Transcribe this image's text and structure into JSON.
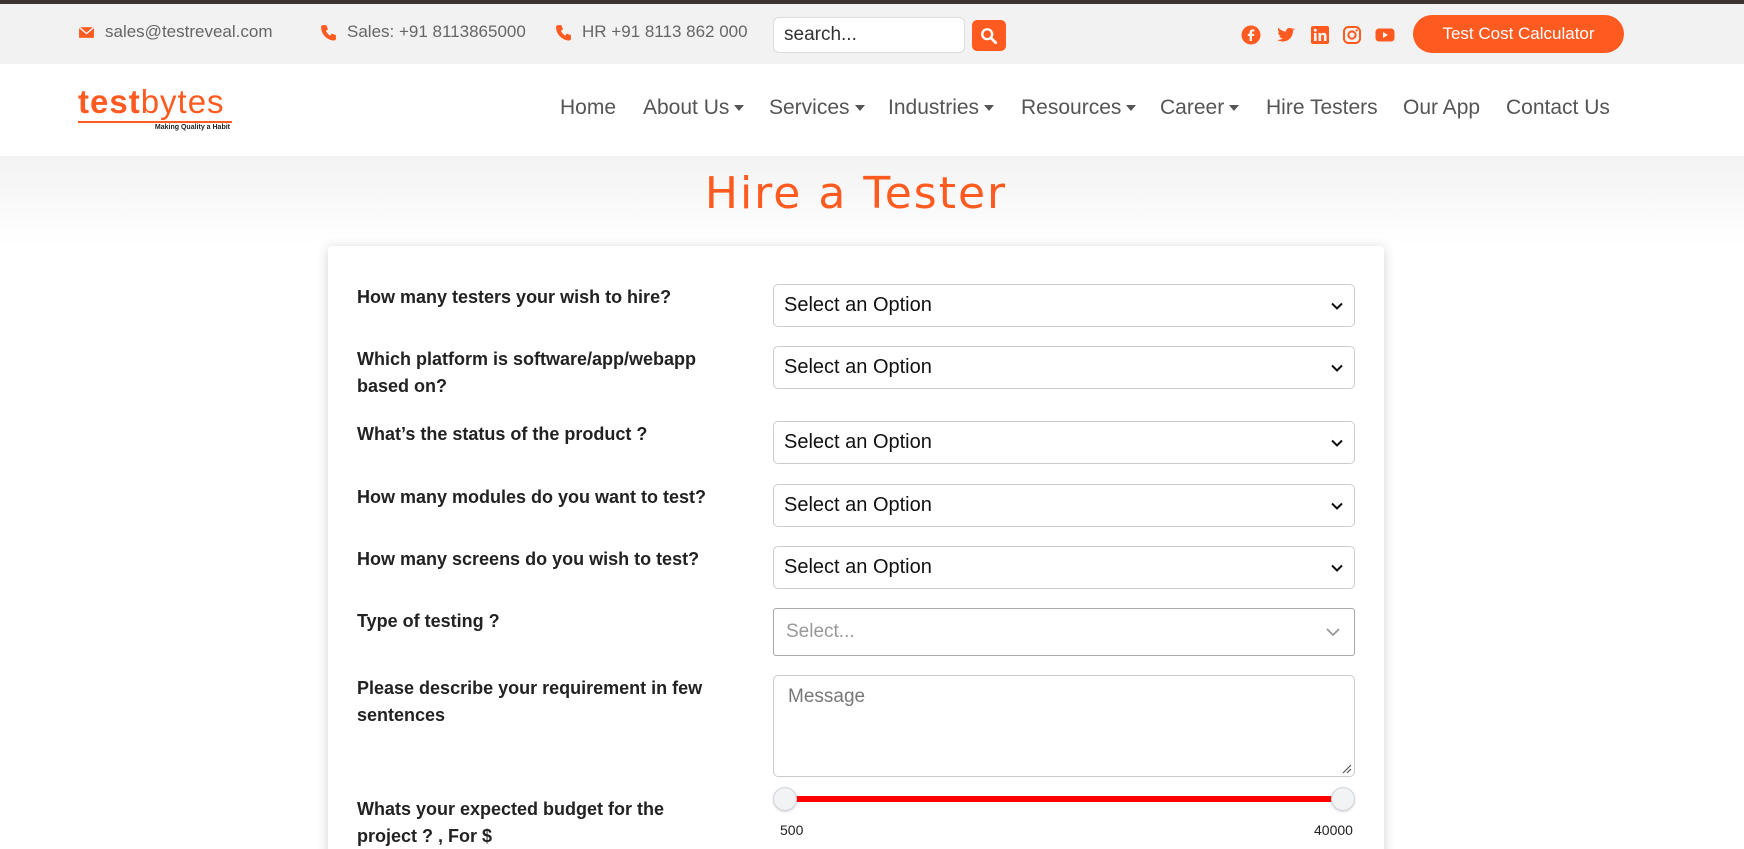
{
  "topbar": {
    "email": "sales@testreveal.com",
    "sales_phone": "Sales: +91 8113865000",
    "hr_phone": "HR +91 8113 862 000",
    "search_placeholder": "search...",
    "social_icons": [
      "facebook-icon",
      "twitter-icon",
      "linkedin-icon",
      "instagram-icon",
      "youtube-icon"
    ],
    "cta_label": "Test Cost Calculator"
  },
  "logo": {
    "part1": "test",
    "part2": "bytes",
    "tagline": "Making Quality a Habit"
  },
  "nav": {
    "items": [
      {
        "label": "Home"
      },
      {
        "label": "About Us"
      },
      {
        "label": "Services"
      },
      {
        "label": "Industries"
      },
      {
        "label": "Resources"
      },
      {
        "label": "Career"
      },
      {
        "label": "Hire Testers"
      },
      {
        "label": "Our App"
      },
      {
        "label": "Contact Us"
      }
    ]
  },
  "page": {
    "title": "Hire a Tester"
  },
  "form": {
    "questions": [
      {
        "label": "How many testers your wish to hire?",
        "value": "Select an Option"
      },
      {
        "label": "Which platform is software/app/webapp based on?",
        "value": "Select an Option"
      },
      {
        "label": "What’s the status of the product ?",
        "value": "Select an Option"
      },
      {
        "label": "How many modules do you want to test?",
        "value": "Select an Option"
      },
      {
        "label": "How many screens do you wish to test?",
        "value": "Select an Option"
      }
    ],
    "testing_type": {
      "label": "Type of testing ?",
      "placeholder": "Select..."
    },
    "requirement": {
      "label": "Please describe your requirement in few sentences",
      "placeholder": "Message"
    },
    "budget": {
      "label": "Whats your expected budget for the project ? , For $",
      "min": "500",
      "max": "40000"
    }
  },
  "colors": {
    "accent": "#ff5a1f",
    "slider": "#ff0000"
  }
}
